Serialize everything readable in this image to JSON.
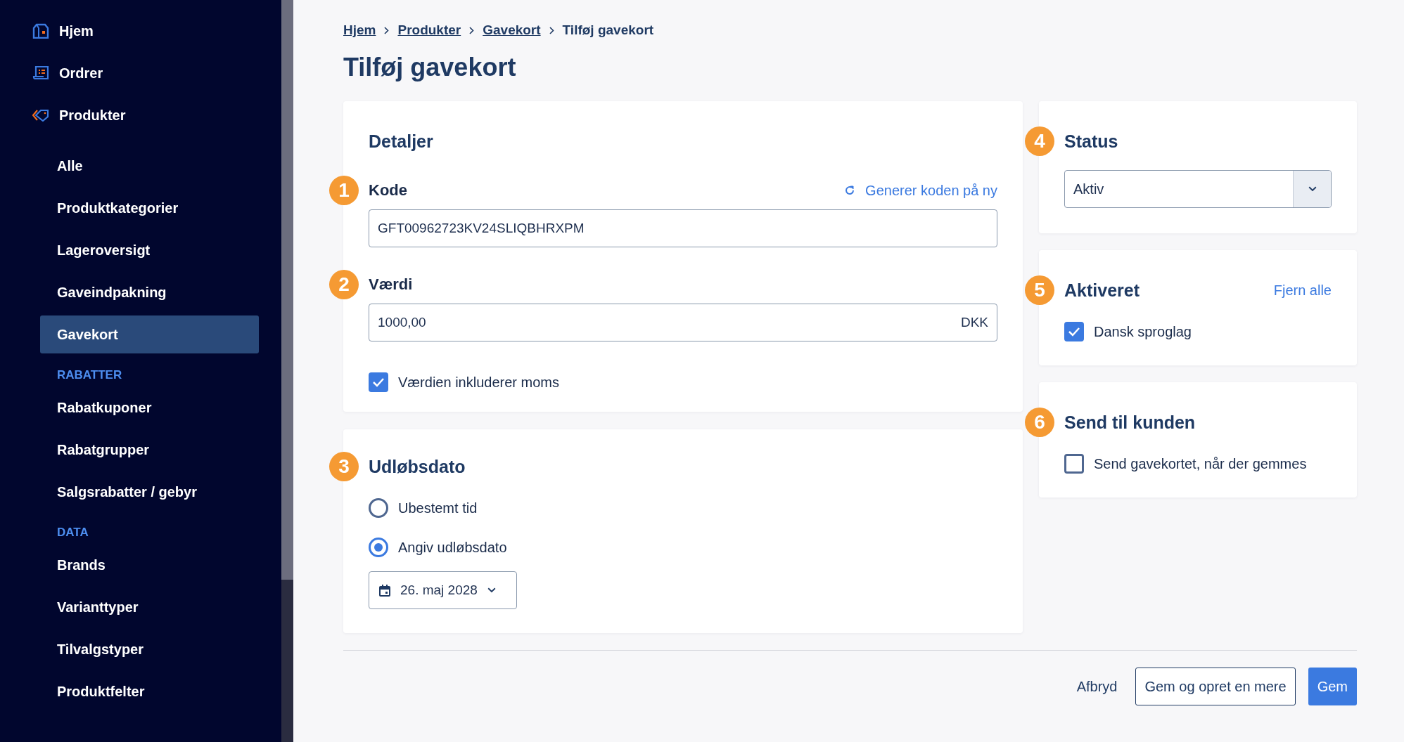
{
  "sidebar": {
    "nav": [
      {
        "label": "Hjem",
        "selected": false
      },
      {
        "label": "Ordrer",
        "selected": false
      },
      {
        "label": "Produkter",
        "selected": false
      }
    ],
    "sub_items": [
      {
        "label": "Alle",
        "selected": false
      },
      {
        "label": "Produktkategorier",
        "selected": false
      },
      {
        "label": "Lageroversigt",
        "selected": false
      },
      {
        "label": "Gaveindpakning",
        "selected": false
      },
      {
        "label": "Gavekort",
        "selected": true
      }
    ],
    "sections": [
      {
        "heading": "RABATTER",
        "items": [
          {
            "label": "Rabatkuponer",
            "selected": false
          },
          {
            "label": "Rabatgrupper",
            "selected": false
          },
          {
            "label": "Salgsrabatter / gebyr",
            "selected": false
          }
        ]
      },
      {
        "heading": "DATA",
        "items": [
          {
            "label": "Brands",
            "selected": false
          },
          {
            "label": "Varianttyper",
            "selected": false
          },
          {
            "label": "Tilvalgstyper",
            "selected": false
          },
          {
            "label": "Produktfelter",
            "selected": false
          }
        ]
      }
    ]
  },
  "breadcrumb": [
    {
      "label": "Hjem",
      "current": false
    },
    {
      "label": "Produkter",
      "current": false
    },
    {
      "label": "Gavekort",
      "current": false
    },
    {
      "label": "Tilføj gavekort",
      "current": true
    }
  ],
  "page_title": "Tilføj gavekort",
  "details": {
    "title": "Detaljer",
    "code": {
      "badge": "1",
      "label": "Kode",
      "action": "Generer koden på ny",
      "value": "GFT00962723KV24SLIQBHRXPM"
    },
    "amount": {
      "badge": "2",
      "label": "Værdi",
      "value": "1000,00",
      "suffix": "DKK"
    },
    "includes_vat": {
      "label": "Værdien inkluderer moms",
      "checked": true
    }
  },
  "expiry": {
    "badge": "3",
    "title": "Udløbsdato",
    "options": [
      {
        "label": "Ubestemt tid",
        "selected": false
      },
      {
        "label": "Angiv udløbsdato",
        "selected": true
      }
    ],
    "date": "26. maj 2028"
  },
  "status": {
    "badge": "4",
    "title": "Status",
    "value": "Aktiv"
  },
  "activated": {
    "badge": "5",
    "title": "Aktiveret",
    "action": "Fjern alle",
    "items": [
      {
        "label": "Dansk sproglag",
        "checked": true
      }
    ]
  },
  "send": {
    "badge": "6",
    "title": "Send til kunden",
    "option": {
      "label": "Send gavekortet, når der gemmes",
      "checked": false
    }
  },
  "actions": {
    "cancel": "Afbryd",
    "save_and_new": "Gem og opret en mere",
    "save": "Gem"
  }
}
